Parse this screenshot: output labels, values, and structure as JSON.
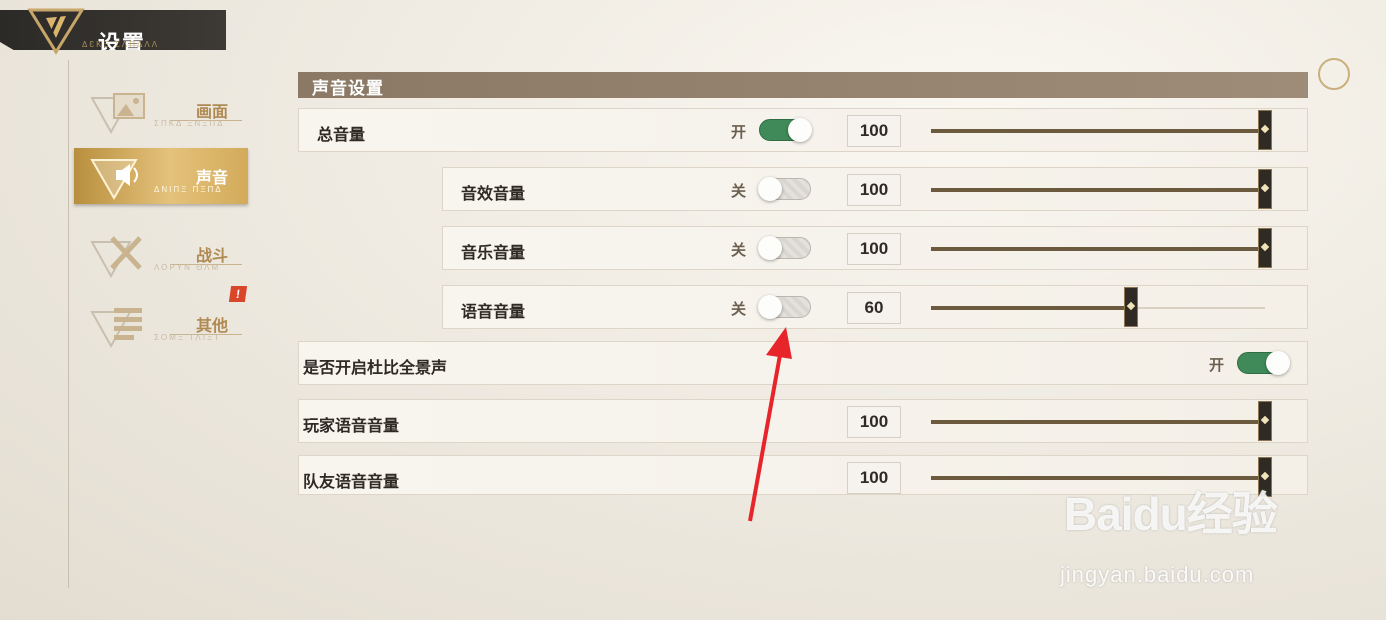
{
  "header": {
    "title": "设置",
    "subtitle": "ΔƐΚΞ ΣΛΠΔΛΛ"
  },
  "sidebar": {
    "items": [
      {
        "label": "画面",
        "sub": "ΣΠΚΔ ΞΝΞΠΔ",
        "icon": "picture-icon",
        "active": false,
        "badge": ""
      },
      {
        "label": "声音",
        "sub": "ΔΝΙΠΞ ΠΞΠΔ",
        "icon": "speaker-icon",
        "active": true,
        "badge": ""
      },
      {
        "label": "战斗",
        "sub": "ΛΟΡΥΝ ΘΛΜ",
        "icon": "crossed-swords-icon",
        "active": false,
        "badge": ""
      },
      {
        "label": "其他",
        "sub": "ΣΟΜΞ ΤΛΙΞΤ",
        "icon": "list-icon",
        "active": false,
        "badge": "!"
      }
    ]
  },
  "section": {
    "title": "声音设置"
  },
  "rows": [
    {
      "label": "总音量",
      "toggle_state": "开",
      "toggle_on": true,
      "value": "100",
      "level": 1.0
    },
    {
      "label": "音效音量",
      "toggle_state": "关",
      "toggle_on": false,
      "value": "100",
      "level": 1.0
    },
    {
      "label": "音乐音量",
      "toggle_state": "关",
      "toggle_on": false,
      "value": "100",
      "level": 1.0
    },
    {
      "label": "语音音量",
      "toggle_state": "关",
      "toggle_on": false,
      "value": "60",
      "level": 0.6
    },
    {
      "label": "是否开启杜比全景声",
      "toggle_state": "开",
      "toggle_on": true
    },
    {
      "label": "玩家语音音量",
      "value": "100",
      "level": 1.0
    },
    {
      "label": "队友语音音量",
      "value": "100",
      "level": 1.0
    }
  ],
  "watermark": {
    "logo": "Baidu经验",
    "url": "jingyan.baidu.com"
  },
  "colors": {
    "accent_gold": "#d3aa5a",
    "toggle_on": "#3f8a58",
    "section_header": "#8b7966",
    "annotation_arrow": "#e8242b"
  }
}
